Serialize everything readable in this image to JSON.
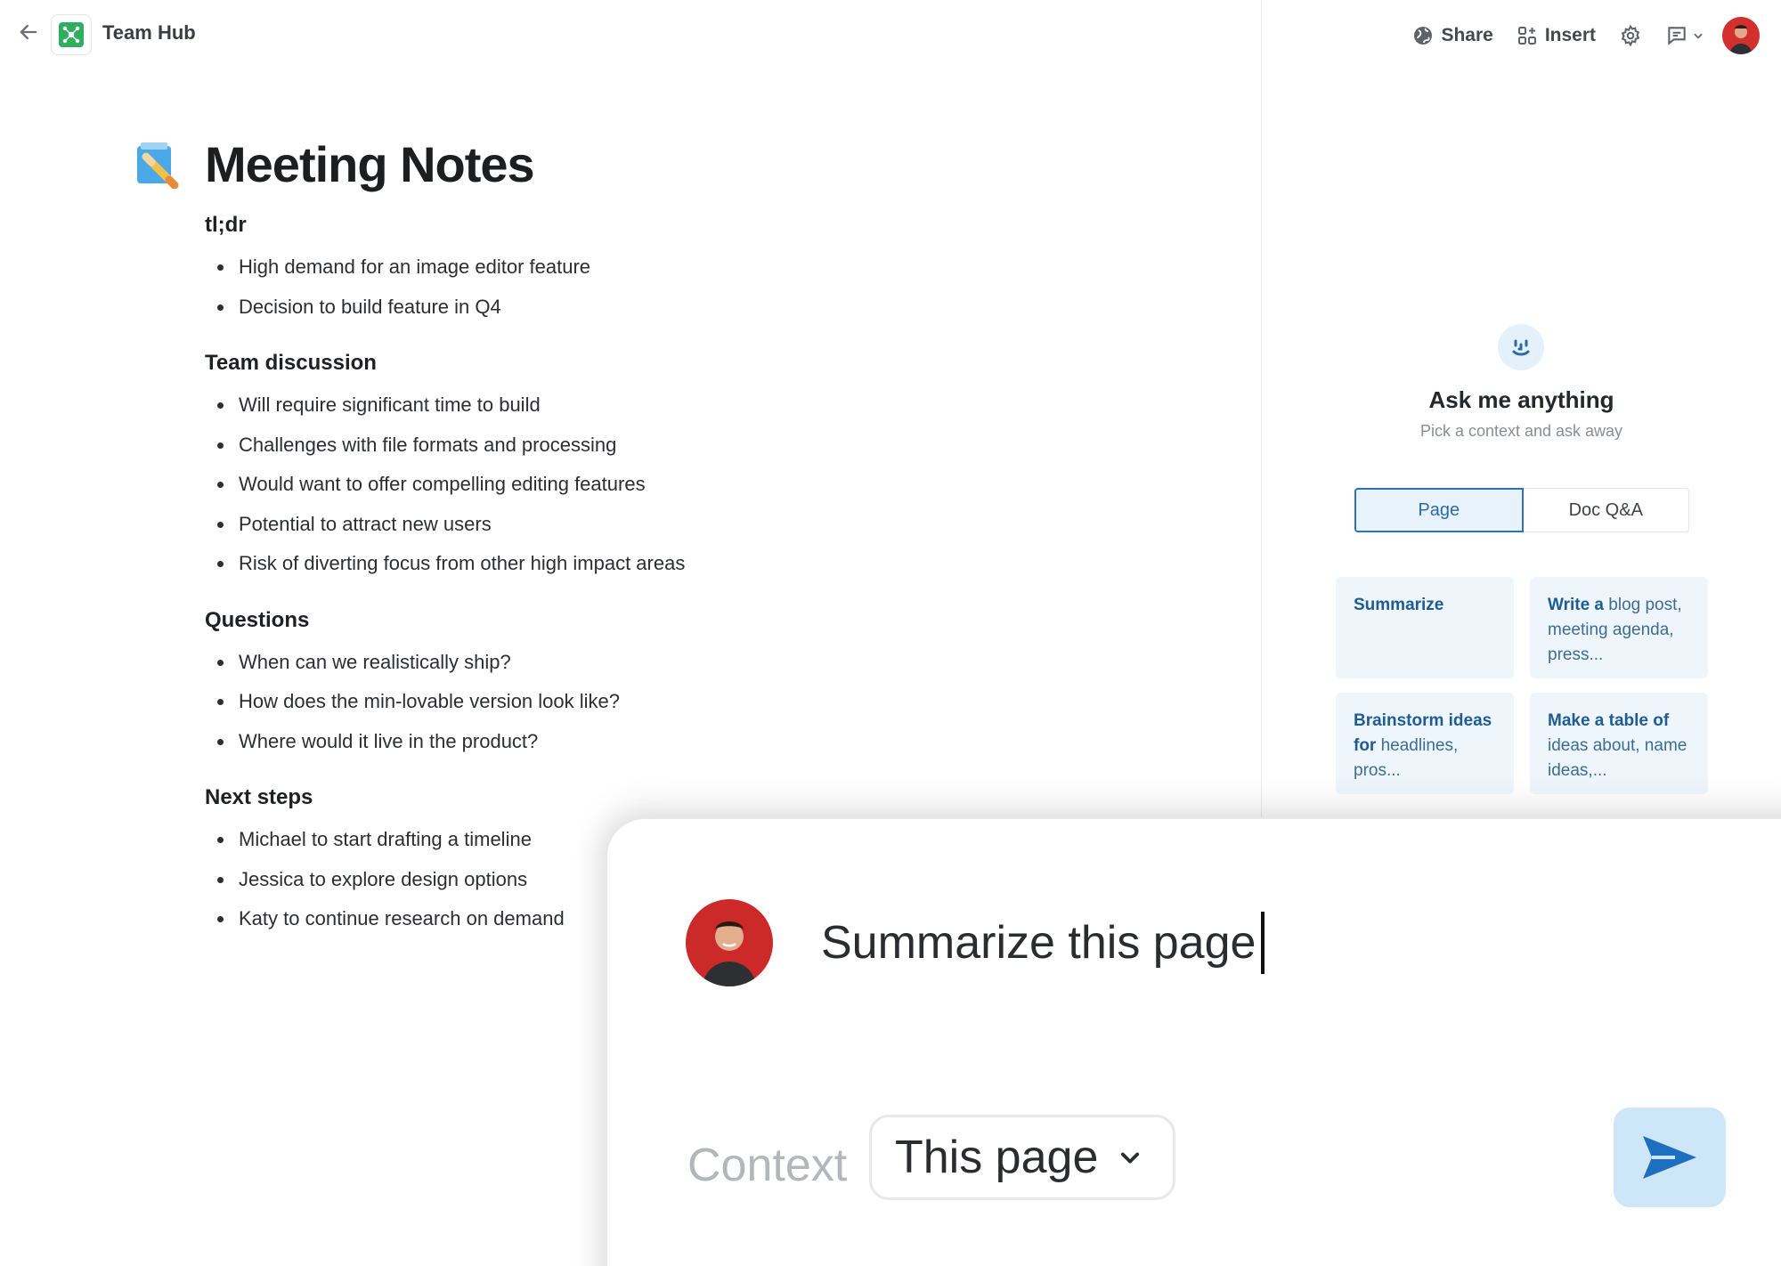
{
  "topbar": {
    "back_icon": "arrow-left-icon",
    "hub_name": "Team Hub",
    "share_label": "Share",
    "insert_label": "Insert"
  },
  "doc": {
    "title": "Meeting Notes",
    "sections": [
      {
        "heading": "tl;dr",
        "items": [
          "High demand for an image editor feature",
          "Decision to build feature in Q4"
        ]
      },
      {
        "heading": "Team discussion",
        "items": [
          "Will require significant time to build",
          "Challenges with file formats and processing",
          "Would want to offer compelling editing features",
          "Potential to attract new users",
          "Risk of diverting focus from other high impact areas"
        ]
      },
      {
        "heading": "Questions",
        "items": [
          "When can we realistically ship?",
          "How does the min-lovable version look like?",
          "Where would it live in the product?"
        ]
      },
      {
        "heading": "Next steps",
        "items": [
          "Michael to start drafting a timeline",
          "Jessica to explore design options",
          "Katy to continue research on demand"
        ]
      }
    ]
  },
  "assistant": {
    "title": "Ask me anything",
    "subtitle": "Pick a context and ask away",
    "tabs": [
      "Page",
      "Doc Q&A"
    ],
    "active_tab": "Page",
    "cards": [
      {
        "bold": "Summarize",
        "rest": ""
      },
      {
        "bold": "Write a",
        "rest": " blog post, meeting agenda, press..."
      },
      {
        "bold": "Brainstorm ideas for",
        "rest": " headlines, pros..."
      },
      {
        "bold": "Make a table of",
        "rest": " ideas about, name ideas,..."
      }
    ]
  },
  "prompt": {
    "input_value": "Summarize this page",
    "context_label": "Context",
    "context_value": "This page"
  },
  "colors": {
    "accent": "#2b73b7",
    "card_bg": "#eef5fb",
    "send_bg": "#cde6f8",
    "hub_logo": "#2fae5d"
  }
}
